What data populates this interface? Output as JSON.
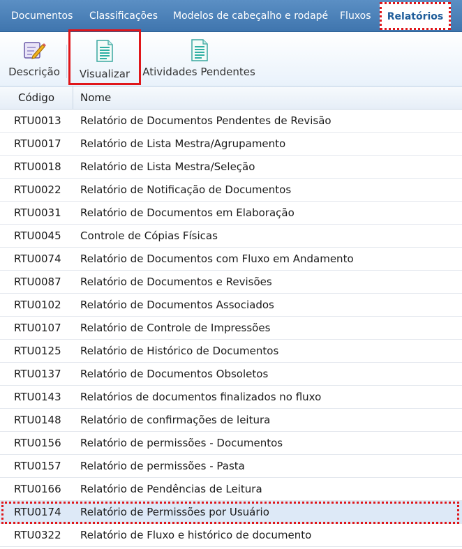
{
  "tabs": [
    {
      "label": "Documentos"
    },
    {
      "label": "Classificações"
    },
    {
      "label": "Modelos de cabeçalho e rodapé"
    },
    {
      "label": "Fluxos"
    },
    {
      "label": "Relatórios",
      "active": true
    }
  ],
  "toolbar": {
    "descricao_label": "Descrição",
    "visualizar_label": "Visualizar",
    "atividades_label": "Atividades Pendentes"
  },
  "grid": {
    "headers": {
      "codigo": "Código",
      "nome": "Nome"
    },
    "rows": [
      {
        "codigo": "RTU0013",
        "nome": "Relatório de Documentos Pendentes de Revisão"
      },
      {
        "codigo": "RTU0017",
        "nome": "Relatório de Lista Mestra/Agrupamento"
      },
      {
        "codigo": "RTU0018",
        "nome": "Relatório de Lista Mestra/Seleção"
      },
      {
        "codigo": "RTU0022",
        "nome": "Relatório de Notificação de Documentos"
      },
      {
        "codigo": "RTU0031",
        "nome": "Relatório de Documentos em Elaboração"
      },
      {
        "codigo": "RTU0045",
        "nome": "Controle de Cópias Físicas"
      },
      {
        "codigo": "RTU0074",
        "nome": "Relatório de Documentos com Fluxo em Andamento"
      },
      {
        "codigo": "RTU0087",
        "nome": "Relatório de Documentos e Revisões"
      },
      {
        "codigo": "RTU0102",
        "nome": "Relatório de Documentos Associados"
      },
      {
        "codigo": "RTU0107",
        "nome": "Relatório de Controle de Impressões"
      },
      {
        "codigo": "RTU0125",
        "nome": "Relatório de Histórico de Documentos"
      },
      {
        "codigo": "RTU0137",
        "nome": "Relatório de Documentos Obsoletos"
      },
      {
        "codigo": "RTU0143",
        "nome": "Relatórios de documentos finalizados no fluxo"
      },
      {
        "codigo": "RTU0148",
        "nome": "Relatório de confirmações de leitura"
      },
      {
        "codigo": "RTU0156",
        "nome": "Relatório de permissões - Documentos"
      },
      {
        "codigo": "RTU0157",
        "nome": "Relatório de permissões - Pasta"
      },
      {
        "codigo": "RTU0166",
        "nome": "Relatório de Pendências de Leitura"
      },
      {
        "codigo": "RTU0174",
        "nome": "Relatório de Permissões por Usuário",
        "selected": true
      },
      {
        "codigo": "RTU0322",
        "nome": "Relatório de Fluxo e histórico de documento"
      }
    ]
  },
  "icons": {
    "descricao": "edit-pencil-icon",
    "visualizar": "document-icon",
    "atividades": "document-icon"
  },
  "colors": {
    "tabbar": "#4a82bb",
    "active_tab_text": "#1f5d9a",
    "highlight": "#e0161a",
    "selected_row": "#dde9f7"
  }
}
